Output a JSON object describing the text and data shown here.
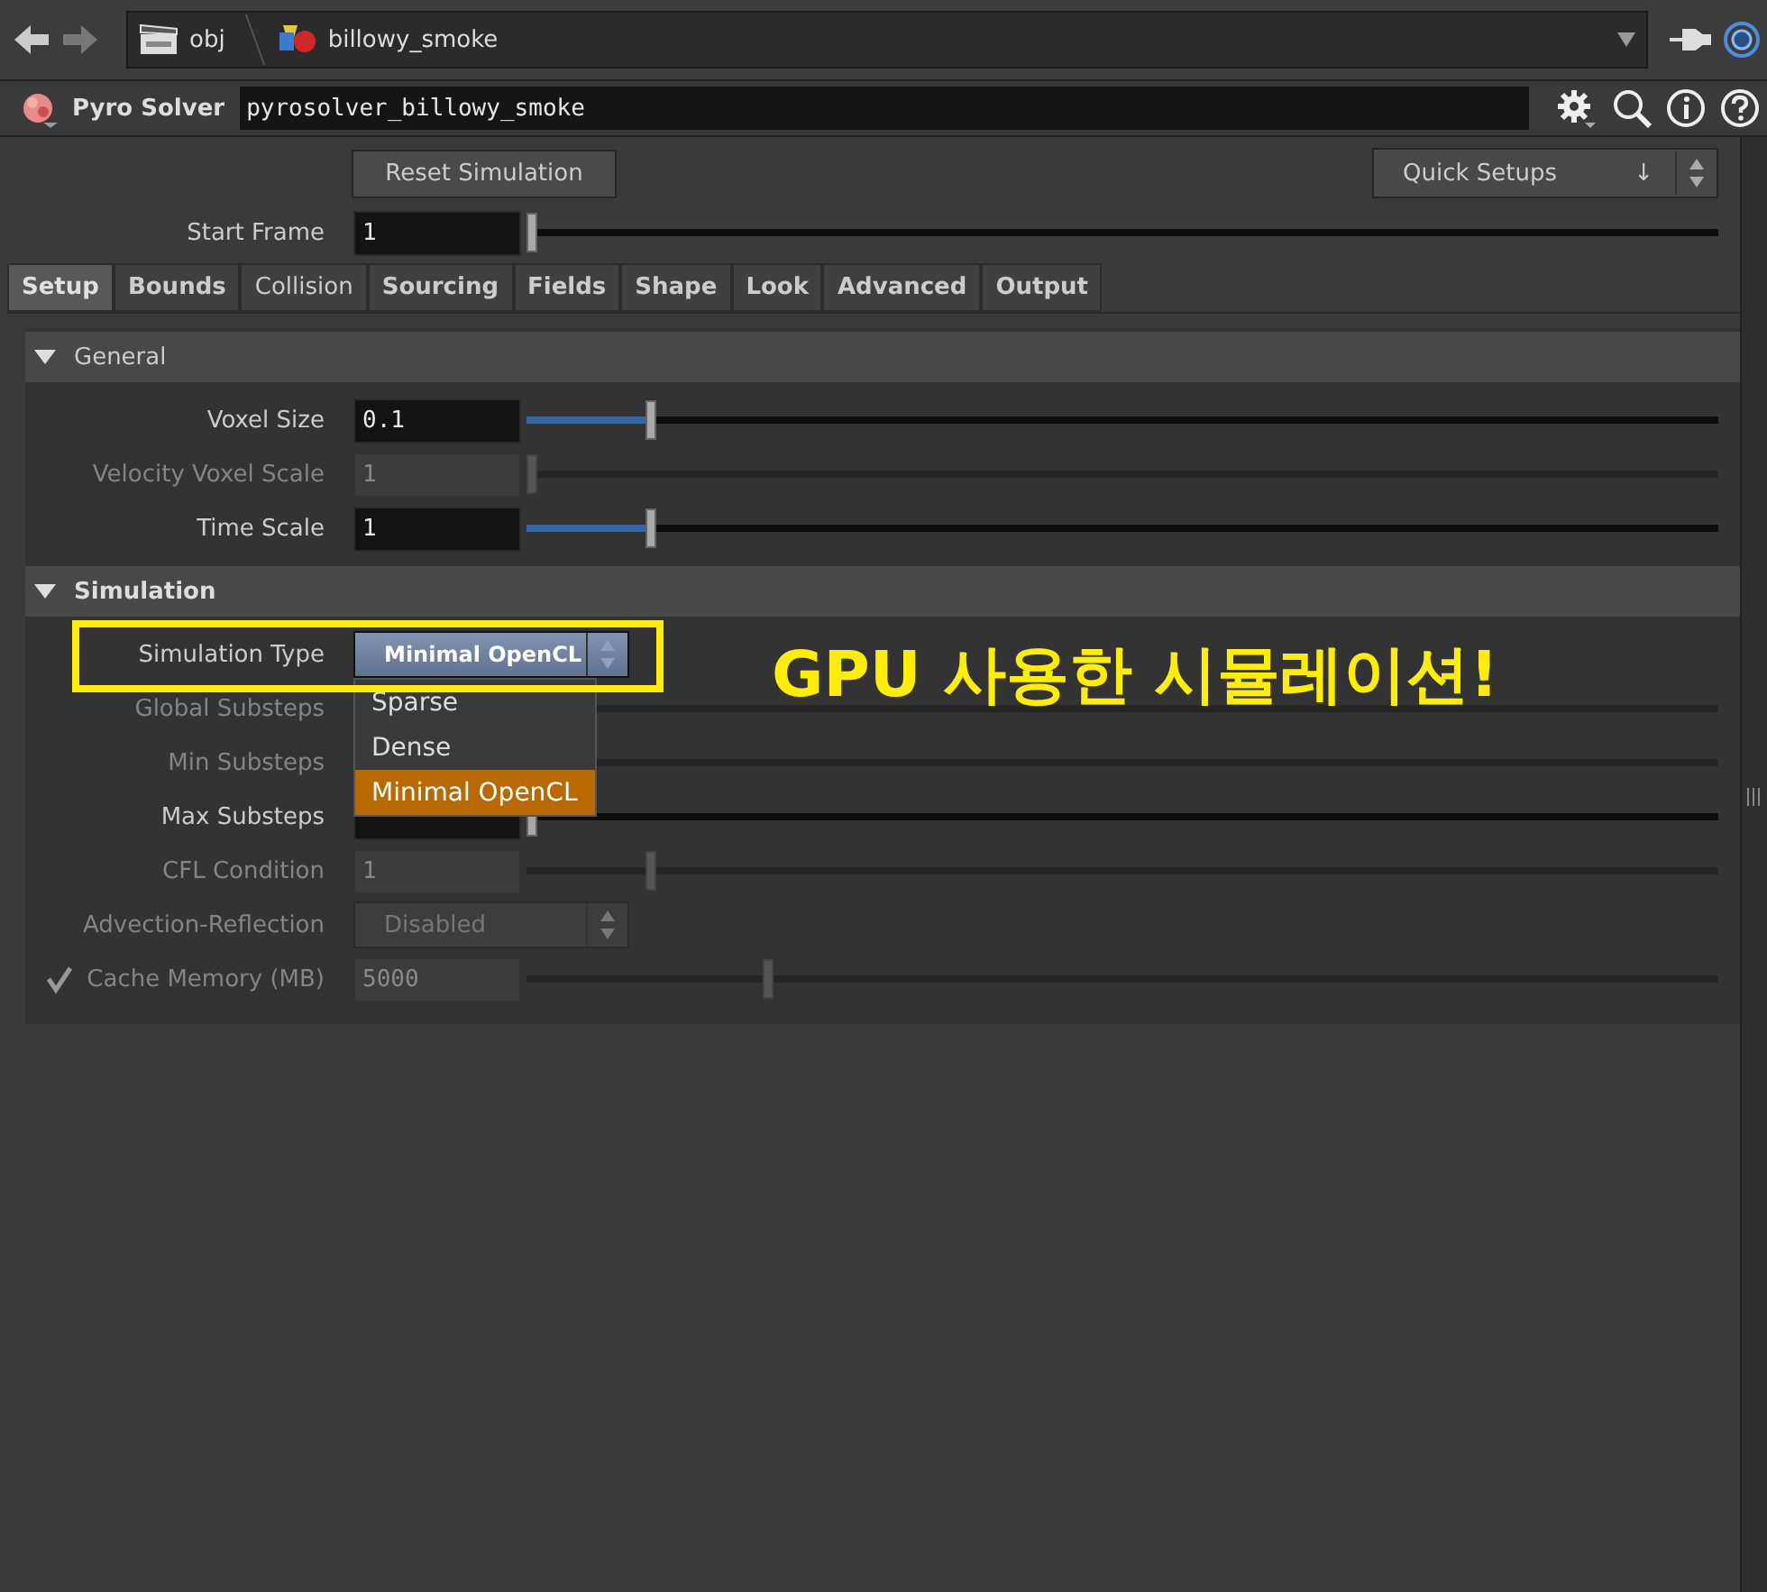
{
  "path_bar": {
    "segments": [
      "obj",
      "billowy_smoke"
    ]
  },
  "node": {
    "type": "Pyro Solver",
    "name": "pyrosolver_billowy_smoke"
  },
  "reset_button": "Reset Simulation",
  "quick_setups": {
    "value": "Quick Setups",
    "arrow": "↓"
  },
  "start_frame": {
    "label": "Start Frame",
    "value": "1",
    "level": 0
  },
  "tabs": [
    {
      "label": "Setup",
      "selected": true,
      "emphasized": true
    },
    {
      "label": "Bounds",
      "selected": false,
      "emphasized": true
    },
    {
      "label": "Collision",
      "selected": false,
      "emphasized": false
    },
    {
      "label": "Sourcing",
      "selected": false,
      "emphasized": true
    },
    {
      "label": "Fields",
      "selected": false,
      "emphasized": true
    },
    {
      "label": "Shape",
      "selected": false,
      "emphasized": true
    },
    {
      "label": "Look",
      "selected": false,
      "emphasized": true
    },
    {
      "label": "Advanced",
      "selected": false,
      "emphasized": true
    },
    {
      "label": "Output",
      "selected": false,
      "emphasized": true
    }
  ],
  "sections": [
    {
      "title": "General",
      "expanded": true,
      "emphasized": false,
      "params": [
        {
          "kind": "slider",
          "label": "Voxel Size",
          "value": "0.1",
          "level": 0.1,
          "disabled": false
        },
        {
          "kind": "slider",
          "label": "Velocity Voxel Scale",
          "value": "1",
          "level": 0,
          "disabled": true
        },
        {
          "kind": "slider",
          "label": "Time Scale",
          "value": "1",
          "level": 0.1,
          "disabled": false
        }
      ]
    },
    {
      "title": "Simulation",
      "expanded": true,
      "emphasized": true,
      "params": [
        {
          "kind": "menu",
          "label": "Simulation Type",
          "value": "Minimal OpenCL",
          "disabled": false,
          "open": true,
          "options": [
            {
              "label": "Sparse",
              "selected": false
            },
            {
              "label": "Dense",
              "selected": false
            },
            {
              "label": "Minimal OpenCL",
              "selected": true
            }
          ]
        },
        {
          "kind": "slider",
          "label": "Global Substeps",
          "disabled": true
        },
        {
          "kind": "slider",
          "label": "Min Substeps",
          "disabled": true
        },
        {
          "kind": "slider",
          "label": "Max Substeps",
          "level": 0,
          "disabled": false
        },
        {
          "kind": "slider",
          "label": "CFL Condition",
          "value": "1",
          "level": 0.1,
          "disabled": true
        },
        {
          "kind": "menu",
          "label": "Advection-Reflection",
          "value": "Disabled",
          "disabled": true,
          "open": false
        },
        {
          "kind": "slider",
          "label": "Cache Memory (MB)",
          "value": "5000",
          "level": 0.2,
          "disabled": true,
          "checked": true
        }
      ]
    }
  ],
  "annotation": {
    "text": "GPU 사용한 시뮬레이션!"
  }
}
